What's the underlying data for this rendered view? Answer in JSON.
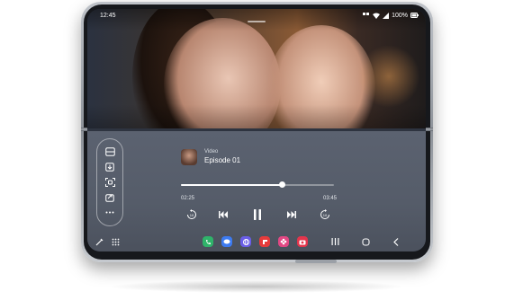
{
  "status_bar": {
    "time": "12:45",
    "battery": "100%"
  },
  "media": {
    "app_label": "Video",
    "title": "Episode 01",
    "elapsed": "02:25",
    "duration": "03:45",
    "progress": 0.66
  },
  "side_panel": {
    "icons": [
      "window-icon",
      "screenshot-icon",
      "capture-icon",
      "share-icon",
      "more-icon"
    ]
  },
  "taskbar": {
    "apps": [
      {
        "name": "phone-app-icon",
        "color": "#2fb36a"
      },
      {
        "name": "messages-app-icon",
        "color": "#3d7bf1"
      },
      {
        "name": "internet-app-icon",
        "color": "#6a5ee8"
      },
      {
        "name": "flipboard-app-icon",
        "color": "#e63b3b"
      },
      {
        "name": "gallery-app-icon",
        "color": "#e24884"
      },
      {
        "name": "camera-app-icon",
        "color": "#e3354c"
      }
    ]
  }
}
